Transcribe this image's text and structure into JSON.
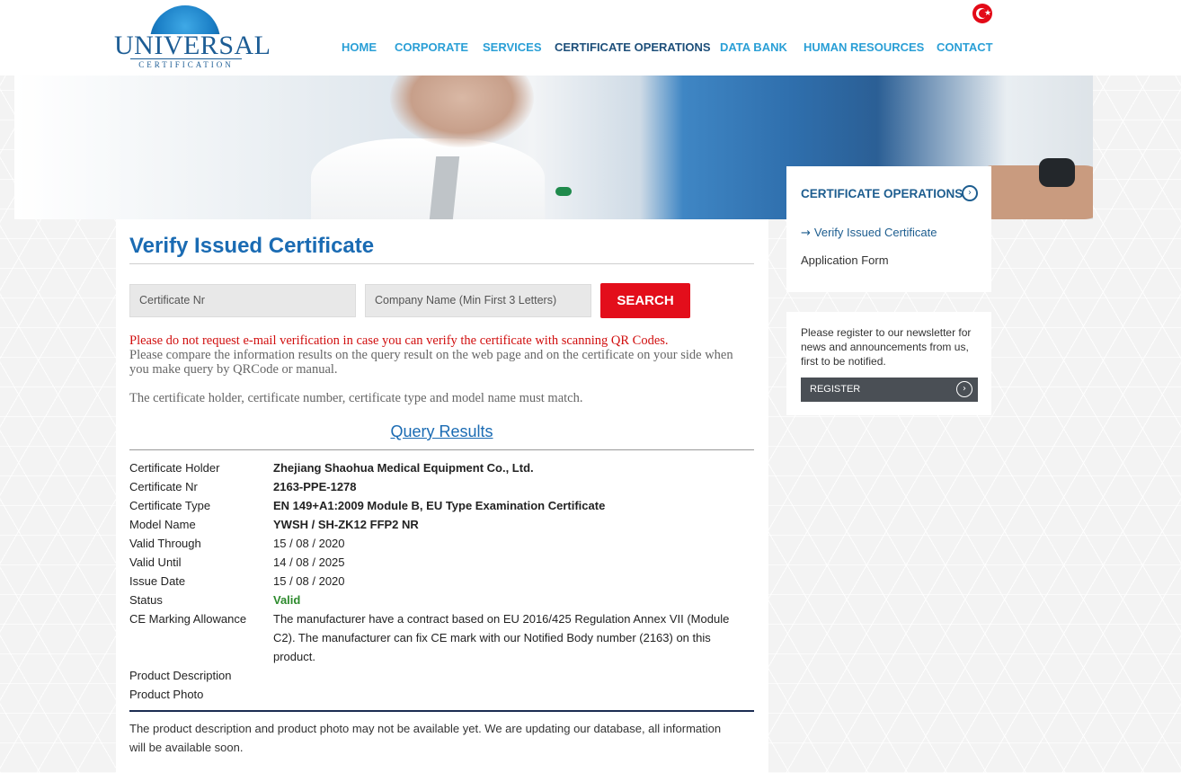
{
  "brand": {
    "name": "UNIVERSAL",
    "tagline": "CERTIFICATION"
  },
  "nav": {
    "items": [
      "HOME",
      "CORPORATE",
      "SERVICES",
      "CERTIFICATE OPERATIONS",
      "DATA BANK",
      "HUMAN RESOURCES",
      "CONTACT"
    ],
    "active": "CERTIFICATE OPERATIONS"
  },
  "colors": {
    "accent": "#2a9fd6",
    "heading": "#1a6bb3",
    "search_button": "#e30e1b",
    "valid": "#2e8b2e",
    "notice": "#d10f0f"
  },
  "main": {
    "title": "Verify Issued Certificate",
    "search": {
      "cert_placeholder": "Certificate Nr",
      "company_placeholder": "Company Name (Min First 3 Letters)",
      "button": "SEARCH"
    },
    "notice_red": "Please do not request e-mail verification in case you can verify the certificate with scanning QR Codes.",
    "notice_gray": "Please compare the information results on the query result on the web page and on the certificate on your side when you make query by QRCode or manual.",
    "notice_match": "The certificate holder, certificate number, certificate type and model name must match.",
    "results_title": "Query Results",
    "results": {
      "holder_label": "Certificate Holder",
      "holder": "Zhejiang Shaohua Medical Equipment Co., Ltd.",
      "nr_label": "Certificate Nr",
      "nr": "2163-PPE-1278",
      "type_label": "Certificate Type",
      "type": "EN 149+A1:2009 Module B, EU Type Examination Certificate",
      "model_label": "Model Name",
      "model": "YWSH / SH-ZK12 FFP2 NR",
      "valid_through_label": "Valid Through",
      "valid_through": "15 / 08 / 2020",
      "valid_until_label": "Valid Until",
      "valid_until": "14 / 08 / 2025",
      "issue_date_label": "Issue Date",
      "issue_date": "15 / 08 / 2020",
      "status_label": "Status",
      "status": "Valid",
      "ce_label": "CE Marking Allowance",
      "ce": "The manufacturer have a contract based on EU 2016/425 Regulation Annex VII (Module C2). The manufacturer can fix CE mark with our Notified Body number (2163) on this product.",
      "product_desc_label": "Product Description",
      "product_photo_label": "Product Photo"
    },
    "footer_note": "The product description and product photo may not be available yet. We are updating our database, all information will be available soon."
  },
  "sidebar": {
    "title": "CERTIFICATE OPERATIONS",
    "items": [
      "Verify Issued Certificate",
      "Application Form"
    ],
    "newsletter_text": "Please register to our newsletter for news and announcements from us, first to be notified.",
    "register_button": "REGISTER"
  }
}
